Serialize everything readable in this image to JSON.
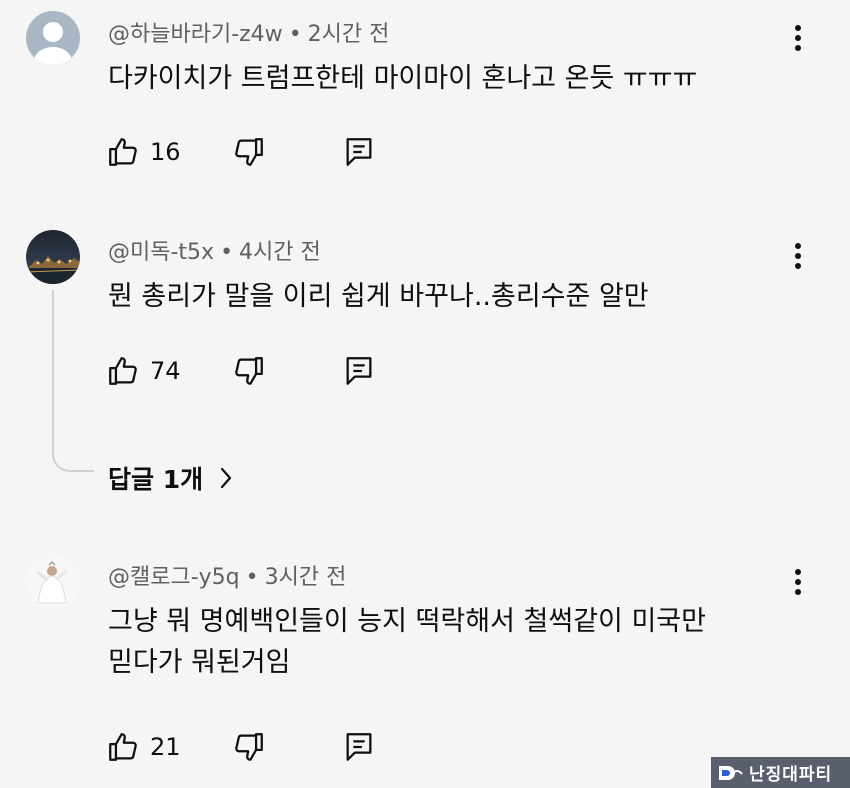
{
  "comments": [
    {
      "author": "@하늘바라기-z4w",
      "time": "2시간 전",
      "text": "다카이치가 트럼프한테 마이마이 혼나고 온듯 ㅠㅠㅠ",
      "likes": "16",
      "avatar": "default-person-avatar"
    },
    {
      "author": "@미독-t5x",
      "time": "4시간 전",
      "text": "뭔 총리가 말을 이리 쉽게 바꾸나..총리수준 알만",
      "likes": "74",
      "avatar": "night-city-photo-avatar",
      "replies_label": "답글 1개"
    },
    {
      "author": "@캘로그-y5q",
      "time": "3시간 전",
      "text_lines": [
        "그냥 뭐 명예백인들이 능지 떡락해서 철썩같이 미국만",
        "믿다가 뭐된거임"
      ],
      "likes": "21",
      "avatar": "white-figure-photo-avatar"
    }
  ],
  "separator": "•",
  "watermark": "난징대파티",
  "icons": {
    "like": "thumbs-up-icon",
    "dislike": "thumbs-down-icon",
    "reply": "comment-reply-icon",
    "more": "more-vertical-icon",
    "chevron": "chevron-right-icon"
  },
  "colors": {
    "background": "#f5f5f5",
    "meta_text": "#606060",
    "body_text": "#0f0f0f",
    "thread_line": "#d0d0d0"
  }
}
